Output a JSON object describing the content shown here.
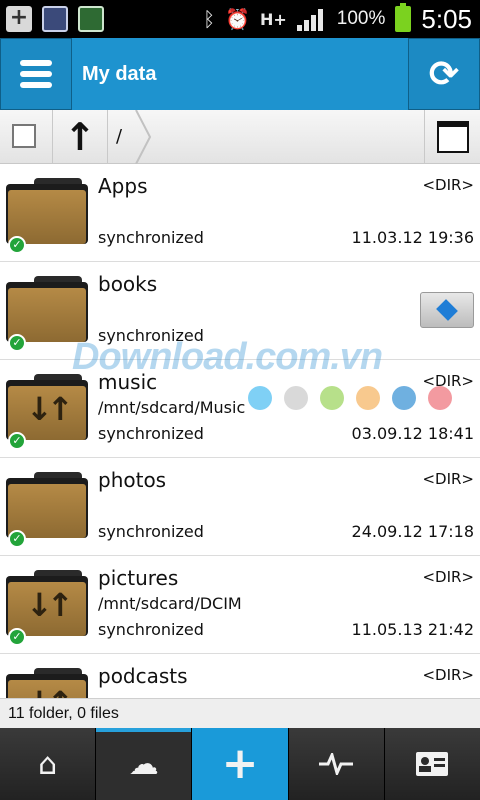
{
  "status_bar": {
    "network": "H+",
    "battery_pct": "100%",
    "time": "5:05"
  },
  "action_bar": {
    "title": "My data"
  },
  "path_bar": {
    "current_path": "/"
  },
  "files": [
    {
      "name": "Apps",
      "path": "",
      "status": "synchronized",
      "type": "<DIR>",
      "date": "11.03.12 19:36",
      "icon": "folder"
    },
    {
      "name": "books",
      "path": "",
      "status": "synchronized",
      "type": "",
      "date": "",
      "icon": "folder"
    },
    {
      "name": "music",
      "path": "/mnt/sdcard/Music",
      "status": "synchronized",
      "type": "<DIR>",
      "date": "03.09.12 18:41",
      "icon": "folder-sync"
    },
    {
      "name": "photos",
      "path": "",
      "status": "synchronized",
      "type": "<DIR>",
      "date": "24.09.12 17:18",
      "icon": "folder"
    },
    {
      "name": "pictures",
      "path": "/mnt/sdcard/DCIM",
      "status": "synchronized",
      "type": "<DIR>",
      "date": "11.05.13 21:42",
      "icon": "folder-sync"
    },
    {
      "name": "podcasts",
      "path": "",
      "status": "",
      "type": "<DIR>",
      "date": "",
      "icon": "folder-sync"
    }
  ],
  "footer": {
    "summary": "11 folder, 0 files"
  },
  "watermark": {
    "text": "Download.com.vn",
    "dot_colors": [
      "#7fd0f5",
      "#d9d9d9",
      "#b7e08a",
      "#f8c98e",
      "#6fb0e0",
      "#f39aa0"
    ]
  },
  "colors": {
    "accent": "#1e93cf",
    "sync_green": "#23a43a"
  }
}
